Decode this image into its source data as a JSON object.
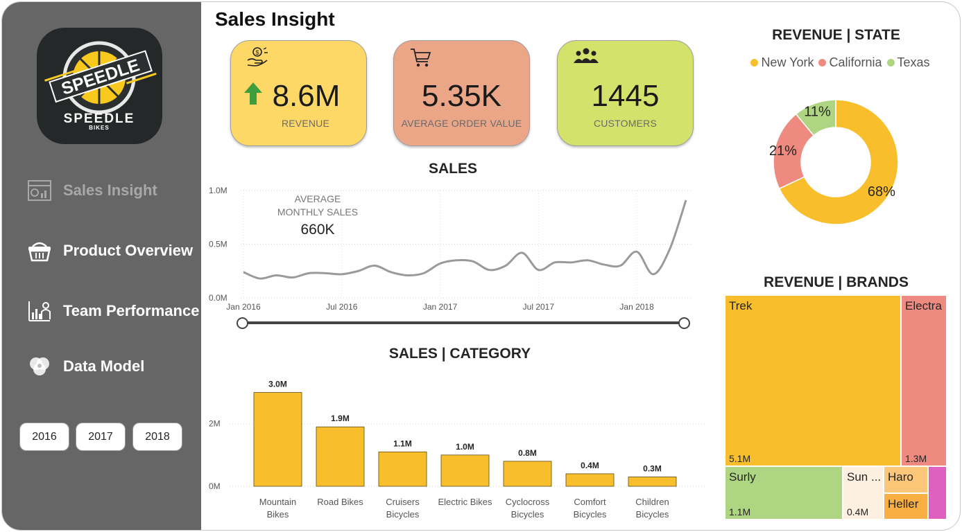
{
  "page": {
    "title": "Sales Insight"
  },
  "brand": {
    "logo_text_top": "SPEEDLE",
    "logo_text_main": "SPEEDLE",
    "logo_text_sub": "BIKES"
  },
  "nav": {
    "items": [
      {
        "label": "Sales Insight",
        "icon": "sales-dashboard-icon",
        "active": true
      },
      {
        "label": "Product Overview",
        "icon": "basket-icon",
        "active": false
      },
      {
        "label": "Team Performance",
        "icon": "team-chart-icon",
        "active": false
      },
      {
        "label": "Data Model",
        "icon": "venn-icon",
        "active": false
      }
    ]
  },
  "years": [
    "2016",
    "2017",
    "2018"
  ],
  "kpis": [
    {
      "value": "8.6M",
      "label": "REVENUE",
      "icon": "money-hand-icon",
      "trend": "up-arrow-icon",
      "color": "#FDD867"
    },
    {
      "value": "5.35K",
      "label": "AVERAGE ORDER VALUE",
      "icon": "cart-icon",
      "color": "#EBA688"
    },
    {
      "value": "1445",
      "label": "CUSTOMERS",
      "icon": "people-group-icon",
      "color": "#D3E26A"
    }
  ],
  "sales_line": {
    "title": "SALES",
    "annotation_label_1": "AVERAGE",
    "annotation_label_2": "MONTHLY SALES",
    "annotation_value": "660K"
  },
  "category_chart": {
    "title": "SALES | CATEGORY"
  },
  "state_chart": {
    "title": "REVENUE | STATE"
  },
  "brands_chart": {
    "title": "REVENUE | BRANDS"
  },
  "colors": {
    "accent": "#F9BE2C",
    "pink": "#EF8A80",
    "green": "#AED581",
    "sidebar": "#666666"
  },
  "chart_data": [
    {
      "type": "line",
      "title": "SALES",
      "x": [
        "2016-01",
        "2016-02",
        "2016-03",
        "2016-04",
        "2016-05",
        "2016-06",
        "2016-07",
        "2016-08",
        "2016-09",
        "2016-10",
        "2016-11",
        "2016-12",
        "2017-01",
        "2017-02",
        "2017-03",
        "2017-04",
        "2017-05",
        "2017-06",
        "2017-07",
        "2017-08",
        "2017-09",
        "2017-10",
        "2017-11",
        "2017-12",
        "2018-01",
        "2018-02",
        "2018-03",
        "2018-04"
      ],
      "x_ticks": [
        "Jan 2016",
        "Jul 2016",
        "Jan 2017",
        "Jul 2017",
        "Jan 2018"
      ],
      "y": [
        0.24,
        0.18,
        0.21,
        0.19,
        0.23,
        0.23,
        0.22,
        0.25,
        0.3,
        0.24,
        0.21,
        0.23,
        0.32,
        0.35,
        0.34,
        0.26,
        0.3,
        0.42,
        0.26,
        0.33,
        0.33,
        0.35,
        0.31,
        0.3,
        0.43,
        0.22,
        0.45,
        0.91
      ],
      "y_ticks": [
        "0.0M",
        "0.5M",
        "1.0M"
      ],
      "ylim": [
        0,
        1.0
      ],
      "grid": true
    },
    {
      "type": "bar",
      "title": "SALES | CATEGORY",
      "categories": [
        "Mountain Bikes",
        "Road Bikes",
        "Cruisers Bicycles",
        "Electric Bikes",
        "Cyclocross Bicycles",
        "Comfort Bicycles",
        "Children Bicycles"
      ],
      "category_lines": [
        [
          "Mountain",
          "Bikes"
        ],
        [
          "Road Bikes"
        ],
        [
          "Cruisers",
          "Bicycles"
        ],
        [
          "Electric Bikes"
        ],
        [
          "Cyclocross",
          "Bicycles"
        ],
        [
          "Comfort",
          "Bicycles"
        ],
        [
          "Children",
          "Bicycles"
        ]
      ],
      "values": [
        3.0,
        1.9,
        1.1,
        1.0,
        0.8,
        0.4,
        0.3
      ],
      "data_labels": [
        "3.0M",
        "1.9M",
        "1.1M",
        "1.0M",
        "0.8M",
        "0.4M",
        "0.3M"
      ],
      "y_ticks": [
        "0M",
        "2M"
      ],
      "ylim": [
        0,
        3.3
      ],
      "grid": true
    },
    {
      "type": "pie",
      "title": "REVENUE | STATE",
      "labels": [
        "New York",
        "California",
        "Texas"
      ],
      "values": [
        68,
        21,
        11
      ],
      "value_labels": [
        "68%",
        "21%",
        "11%"
      ],
      "colors": [
        "#F9BE2C",
        "#EF8A80",
        "#AED581"
      ],
      "legend": "top"
    },
    {
      "type": "treemap",
      "title": "REVENUE | BRANDS",
      "items": [
        {
          "name": "Trek",
          "value_label": "5.1M",
          "color": "#F9BE2C"
        },
        {
          "name": "Electra",
          "value_label": "1.3M",
          "color": "#EF8A80"
        },
        {
          "name": "Surly",
          "value_label": "1.1M",
          "color": "#AED581"
        },
        {
          "name": "Sun ...",
          "value_label": "0.4M",
          "color": "#FDF0E0"
        },
        {
          "name": "Haro",
          "value_label": "",
          "color": "#FDC77A"
        },
        {
          "name": "Heller",
          "value_label": "",
          "color": "#F9AF44"
        },
        {
          "name": "",
          "value_label": "",
          "color": "#E060C0"
        }
      ]
    }
  ]
}
